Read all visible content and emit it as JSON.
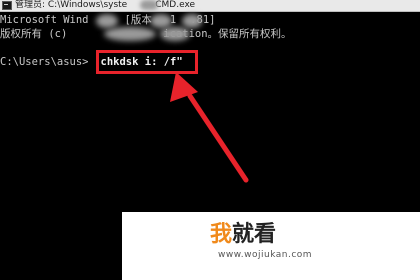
{
  "window": {
    "title": "管理员: C:\\Windows\\syste",
    "title_suffix": "CMD.exe"
  },
  "console": {
    "line1_a": "Microsoft Wind",
    "line1_b": "[版本",
    "line1_c": "1",
    "line1_d": ".81]",
    "line2_a": "版权所有 (c)",
    "line2_b": "ication。保留所有权利。",
    "prompt": "C:\\Users\\asus>",
    "command": "chkdsk i: /f\""
  },
  "watermark": {
    "logo_part1": "我",
    "logo_part2": "就看",
    "url": "www.wojiukan.com"
  },
  "colors": {
    "annotation": "#e8232b",
    "console_text": "#c8c8c8",
    "console_bg": "#000000"
  }
}
